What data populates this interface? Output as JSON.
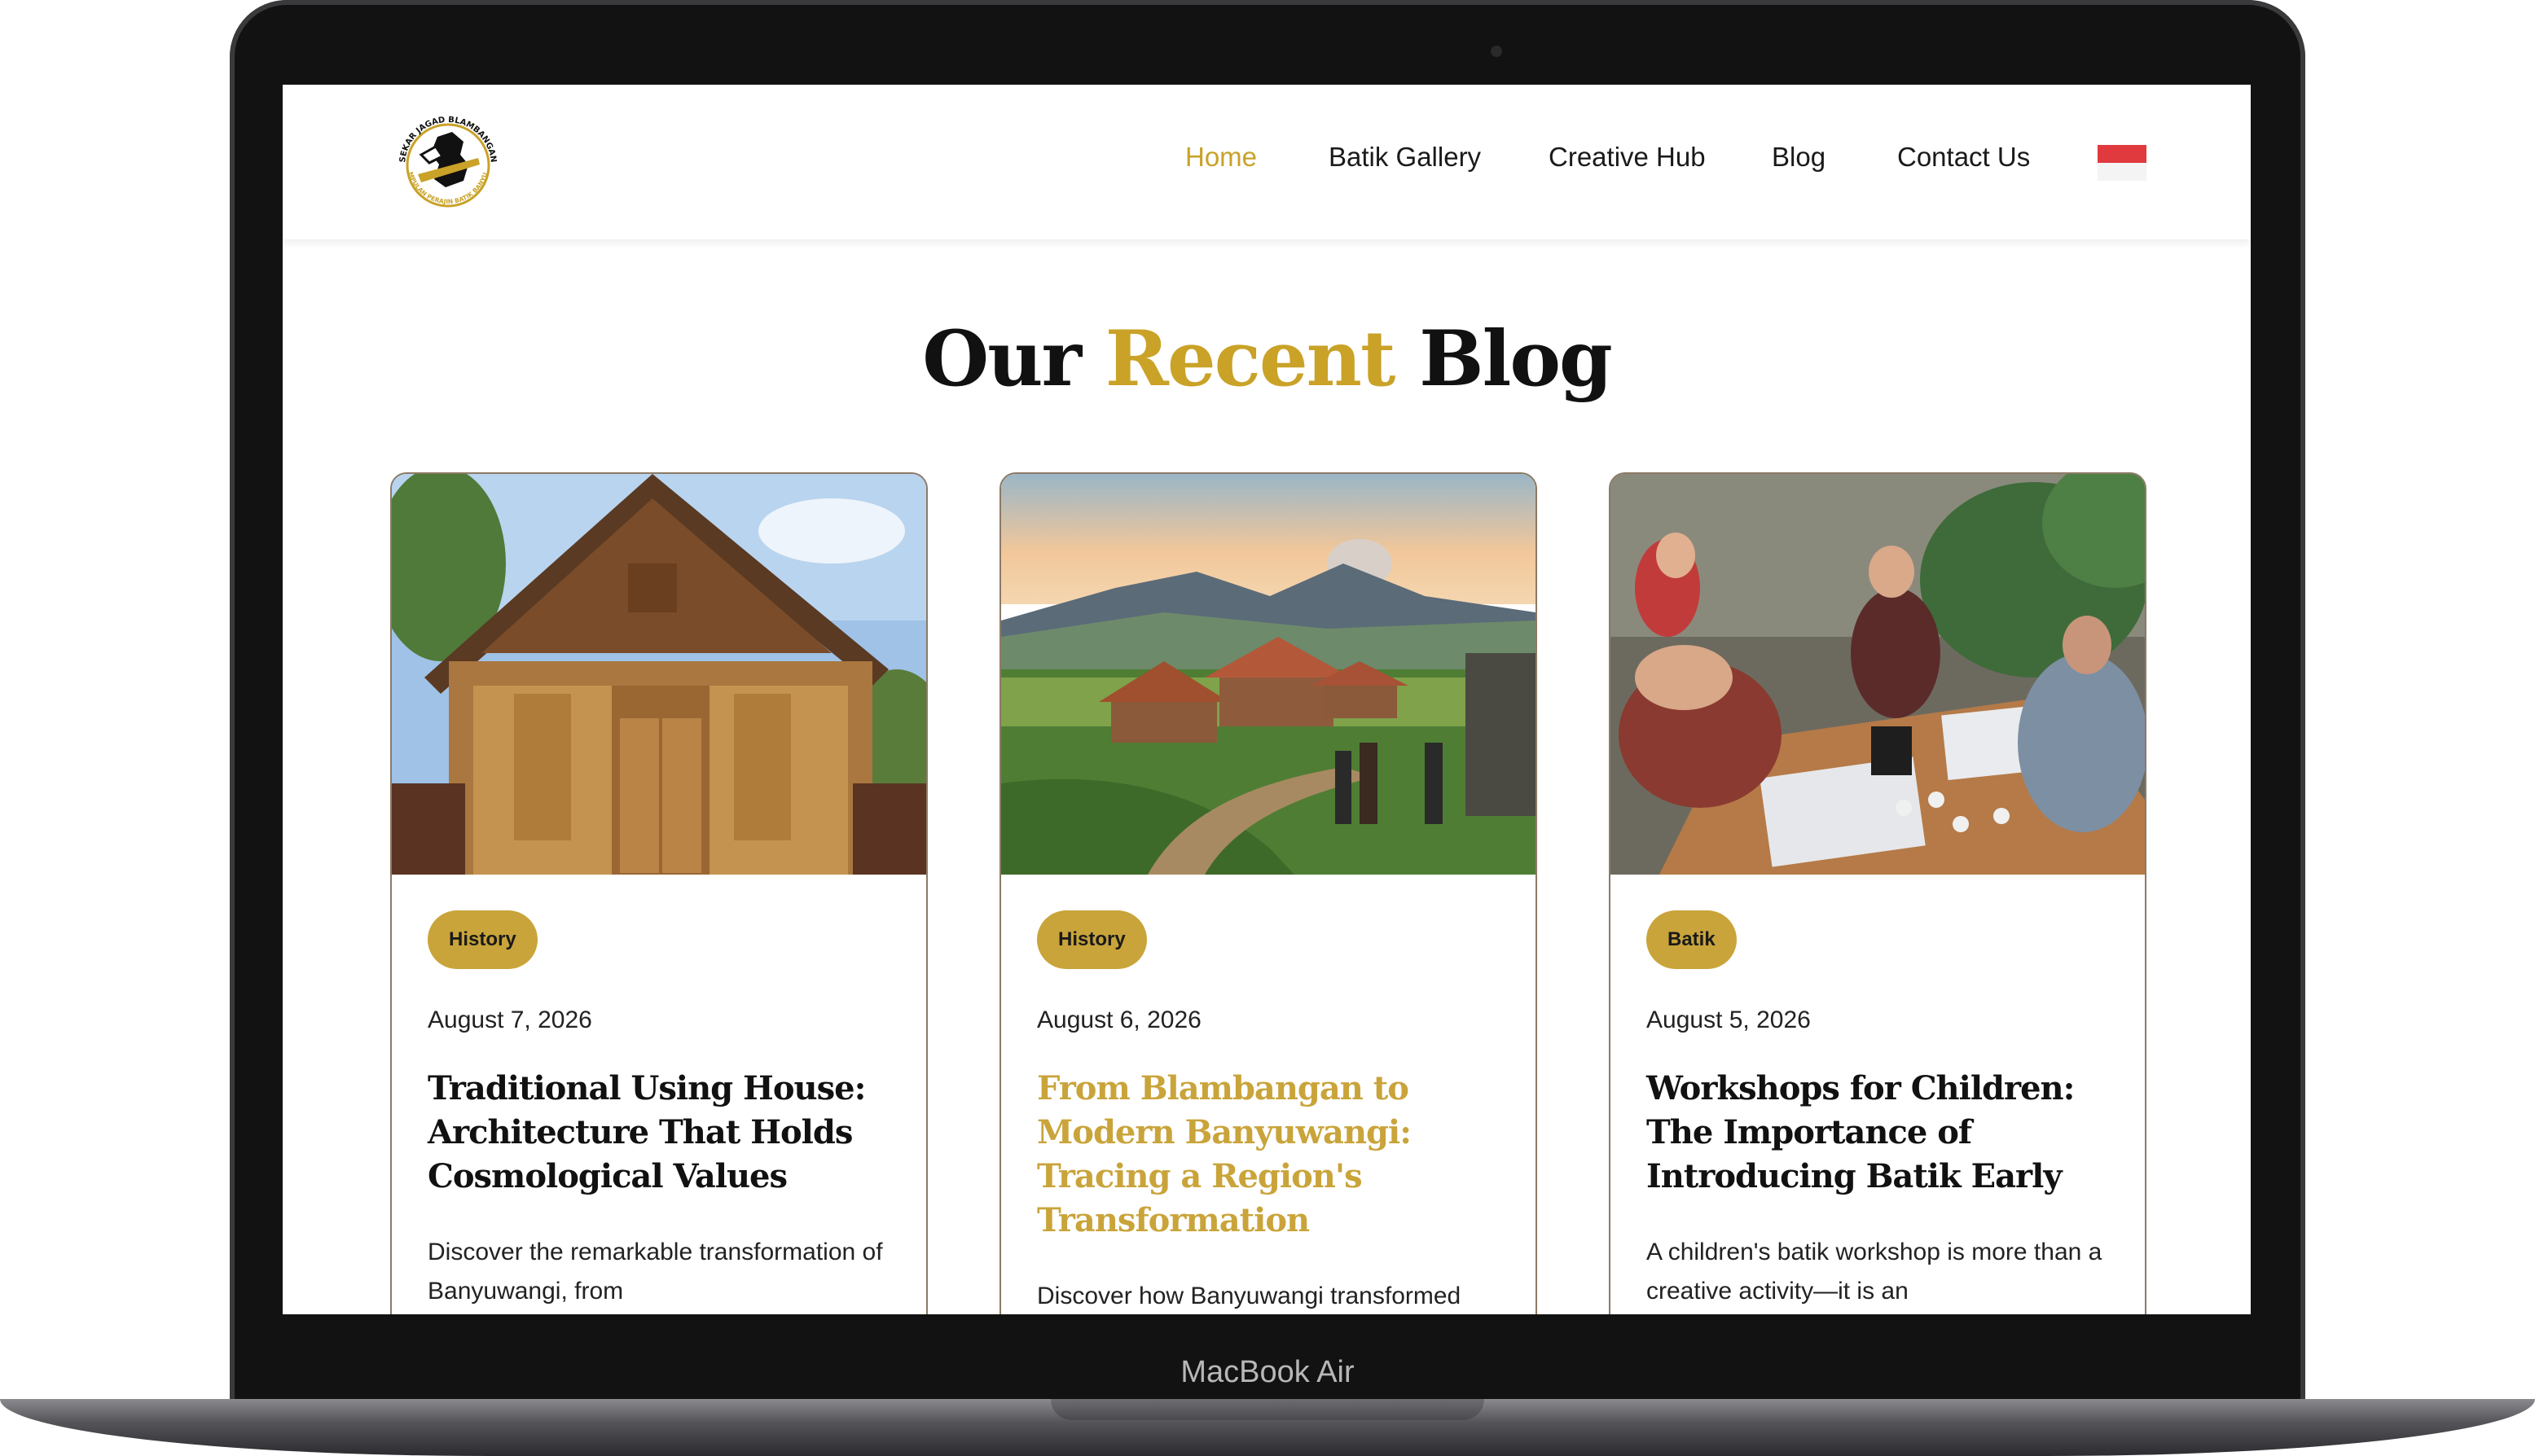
{
  "device": {
    "label": "MacBook Air"
  },
  "navbar": {
    "logo_text_top": "SEKAR JAGAD BLAMBANGAN",
    "logo_text_bottom": "PERKUMPULAN PERAJIN BATIK BANYUWANGI",
    "items": [
      {
        "label": "Home",
        "active": true
      },
      {
        "label": "Batik Gallery",
        "active": false
      },
      {
        "label": "Creative Hub",
        "active": false
      },
      {
        "label": "Blog",
        "active": false
      },
      {
        "label": "Contact Us",
        "active": false
      }
    ],
    "language_flag": "indonesia-flag-icon"
  },
  "section": {
    "title_part1": "Our",
    "title_accent": "Recent",
    "title_part2": "Blog"
  },
  "colors": {
    "accent": "#c9a227",
    "tag": "#c9a43a",
    "text": "#111111"
  },
  "posts": [
    {
      "tag": "History",
      "date": "August 7, 2026",
      "title": "Traditional Using House: Architecture That Holds Cosmological Values",
      "excerpt": "Discover the remarkable transformation of Banyuwangi, from",
      "image": "wooden-traditional-house-photo"
    },
    {
      "tag": "History",
      "date": "August 6, 2026",
      "title": "From Blambangan to Modern Banyuwangi: Tracing a Region's Transformation",
      "excerpt": "Discover how Banyuwangi transformed",
      "image": "volcano-village-landscape-photo"
    },
    {
      "tag": "Batik",
      "date": "August 5, 2026",
      "title": "Workshops for Children: The Importance of Introducing Batik Early",
      "excerpt": "A children's batik workshop is more than a creative activity—it is an",
      "image": "batik-workshop-photo"
    }
  ]
}
